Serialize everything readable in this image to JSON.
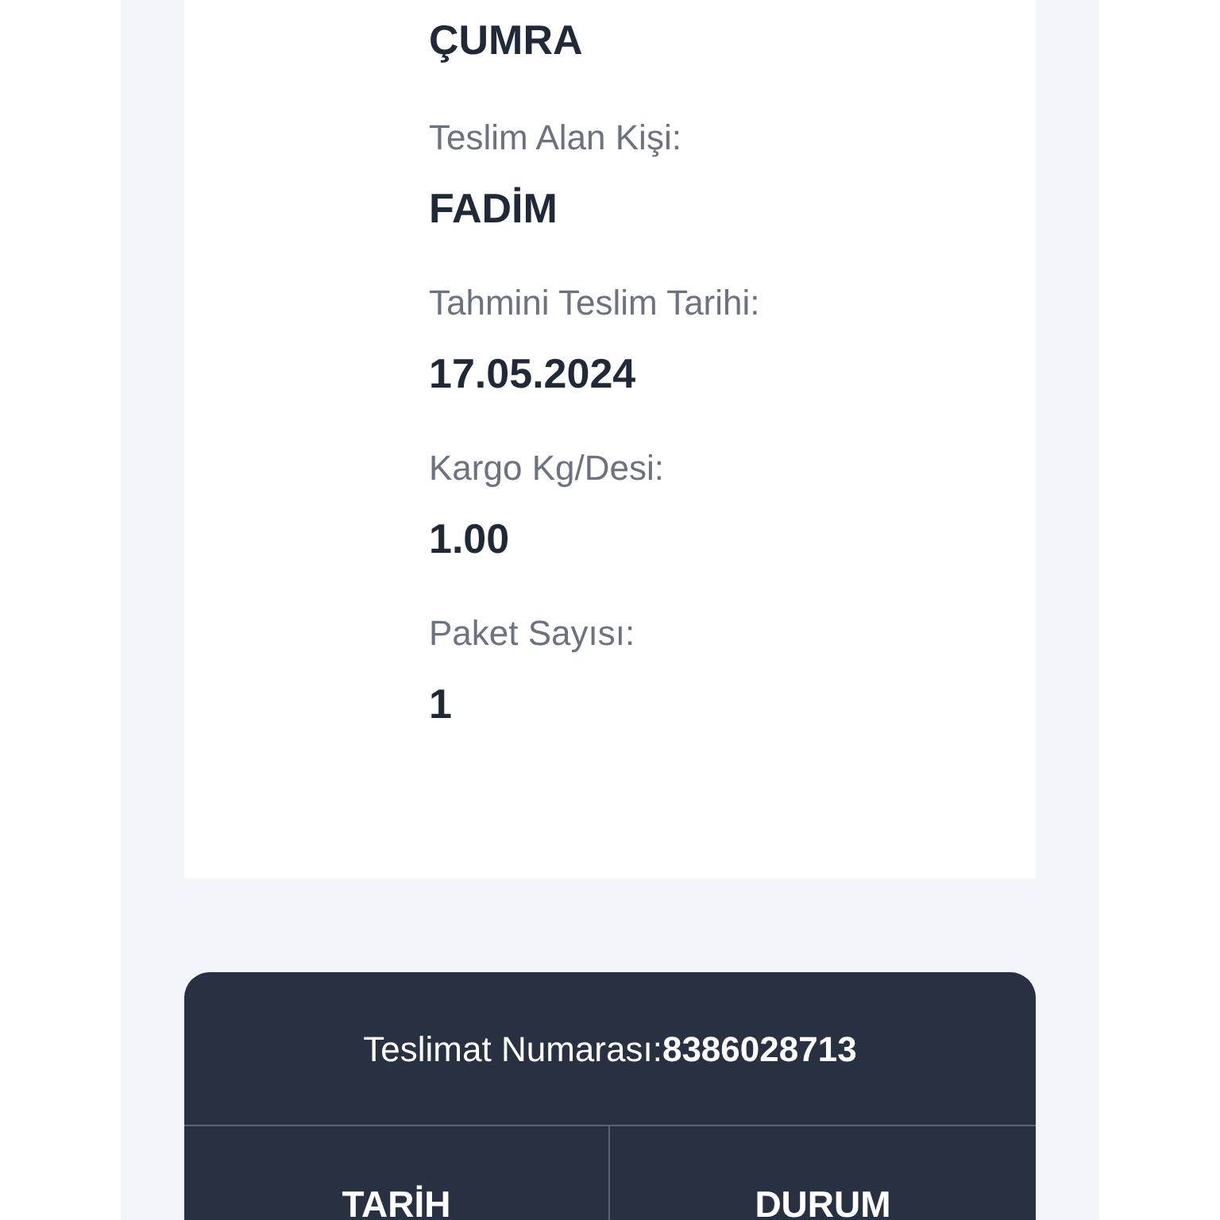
{
  "details": [
    {
      "value": "ÇUMRA"
    },
    {
      "label": "Teslim Alan Kişi:",
      "value": "FADİM"
    },
    {
      "label": "Tahmini Teslim Tarihi:",
      "value": "17.05.2024"
    },
    {
      "label": "Kargo Kg/Desi:",
      "value": "1.00"
    },
    {
      "label": "Paket Sayısı:",
      "value": "1"
    }
  ],
  "history": {
    "title": "Teslimat Numarası:**8386028713**",
    "columns": [
      "TARİH",
      "DURUM"
    ]
  }
}
